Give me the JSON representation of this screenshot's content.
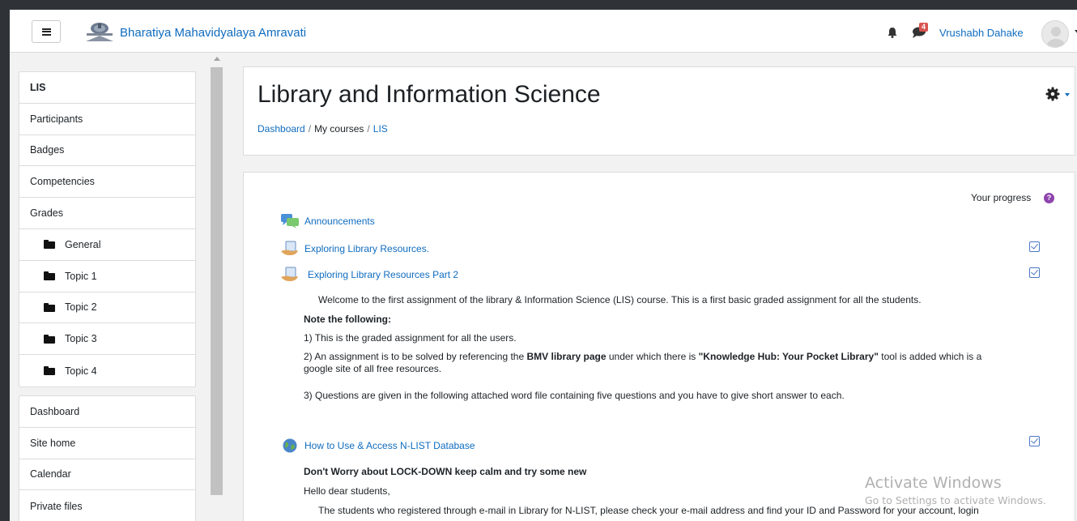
{
  "navbar": {
    "site_name": "Bharatiya Mahavidyalaya Amravati",
    "notification_count": "4",
    "user_name": "Vrushabh Dahake"
  },
  "sidebar": {
    "course_items": [
      {
        "label": "LIS",
        "active": true
      },
      {
        "label": "Participants"
      },
      {
        "label": "Badges"
      },
      {
        "label": "Competencies"
      },
      {
        "label": "Grades"
      },
      {
        "label": "General",
        "icon": "folder-icon"
      },
      {
        "label": "Topic 1",
        "icon": "folder-icon"
      },
      {
        "label": "Topic 2",
        "icon": "folder-icon"
      },
      {
        "label": "Topic 3",
        "icon": "folder-icon"
      },
      {
        "label": "Topic 4",
        "icon": "folder-icon"
      }
    ],
    "site_items": [
      {
        "label": "Dashboard"
      },
      {
        "label": "Site home"
      },
      {
        "label": "Calendar"
      },
      {
        "label": "Private files"
      }
    ]
  },
  "header": {
    "title": "Library and Information Science",
    "breadcrumb": [
      "Dashboard",
      "My courses",
      "LIS"
    ]
  },
  "content": {
    "progress_label": "Your progress",
    "activities": [
      {
        "label": "Announcements",
        "icon": "forum-icon",
        "completed": false
      },
      {
        "label": "Exploring Library Resources.",
        "icon": "assignment-icon",
        "completed": true
      },
      {
        "label": "Exploring Library Resources Part 2",
        "icon": "assignment-icon",
        "completed": true
      },
      {
        "label": "How to Use & Access N-LIST Database",
        "icon": "url-icon",
        "completed": true
      }
    ],
    "assignment_desc": {
      "intro": "Welcome to the first assignment of the library & Information Science (LIS) course. This is a first basic graded assignment for all the students.",
      "note_heading": "Note the following:",
      "point1": "1) This is the graded assignment for all the users.",
      "point2_a": "2) An assignment is to be solved by referencing the ",
      "point2_b": "BMV library page",
      "point2_c": " under which there is ",
      "point2_d": "\"Knowledge Hub: Your Pocket Library\"",
      "point2_e": "  tool is added which is a",
      "point2_f": "google site of all free resources.",
      "point3": "3) Questions are given in the following attached word file containing five questions and you have to give short answer to each."
    },
    "nlist_desc": {
      "heading": "Don't Worry about LOCK-DOWN keep calm and try some new",
      "greeting": "Hello dear students,",
      "body": "The students who registered through e-mail in Library for N-LIST, please check your e-mail address and find your ID and Password for your account, login"
    }
  },
  "watermark": {
    "line1": "Activate Windows",
    "line2": "Go to Settings to activate Windows."
  }
}
